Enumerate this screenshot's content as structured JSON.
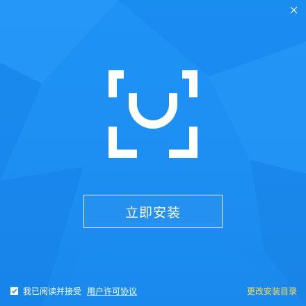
{
  "window": {
    "close_icon": "close-icon",
    "background_color": "#1d8ff3"
  },
  "logo": {
    "icon": "shopping-bag-logo-icon",
    "color": "#ffffff"
  },
  "install_button": {
    "label": "立即安装"
  },
  "footer": {
    "agree_checked": true,
    "agree_text": "我已阅读并接受",
    "license_link": "用户许可协议",
    "change_dir": "更改安装目录",
    "change_dir_color": "#ffd84a"
  }
}
